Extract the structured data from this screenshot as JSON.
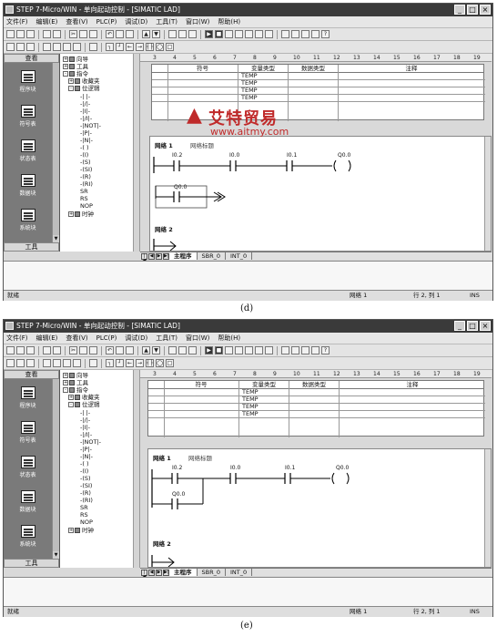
{
  "title": "STEP 7-Micro/WIN - 单向起动控制 - [SIMATIC LAD]",
  "window_buttons": [
    "_",
    "□",
    "×"
  ],
  "menu": [
    "文件(F)",
    "编辑(E)",
    "查看(V)",
    "PLC(P)",
    "调试(D)",
    "工具(T)",
    "窗口(W)",
    "帮助(H)"
  ],
  "nav": {
    "header": "查看",
    "footer": "工具",
    "items": [
      "程序块",
      "符号表",
      "状态表",
      "数据块",
      "系统块"
    ]
  },
  "tree": {
    "items": [
      "向导",
      "工具",
      "指令",
      "收藏夹",
      "位逻辑",
      "-| |-",
      "-|/|-",
      "-|I|-",
      "-|/I|-",
      "-|NOT|-",
      "-|P|-",
      "-|N|-",
      "-( )",
      "-(I)",
      "-(S)",
      "-(SI)",
      "-(R)",
      "-(RI)",
      "SR",
      "RS",
      "NOP",
      "时钟"
    ]
  },
  "ruler": [
    "3",
    "4",
    "5",
    "6",
    "7",
    "8",
    "9",
    "10",
    "11",
    "12",
    "13",
    "14",
    "15",
    "16",
    "17",
    "18",
    "19"
  ],
  "var_table": {
    "headers": [
      "符号",
      "变量类型",
      "数据类型",
      "注释"
    ],
    "rows": [
      "TEMP",
      "TEMP",
      "TEMP",
      "TEMP"
    ]
  },
  "network1": {
    "label": "网络 1",
    "comment": "网络标题"
  },
  "network2": {
    "label": "网络 2"
  },
  "contacts": {
    "c1": "I0.2",
    "c2": "I0.0",
    "c3": "I0.1",
    "coil": "Q0.0",
    "parallel": "Q0.0"
  },
  "tabs": [
    "主程序",
    "SBR_0",
    "INT_0"
  ],
  "status": {
    "left": "就绪",
    "network": "网络 1",
    "position": "行 2, 列 1",
    "mode": "INS"
  },
  "captions": {
    "d": "(d)",
    "e": "(e)"
  },
  "watermark": {
    "cn": "艾特贸易",
    "url": "www.aitmy.com"
  },
  "colors": {
    "watermark": "#c02a2a",
    "title_bar": "#3a3a3a"
  }
}
